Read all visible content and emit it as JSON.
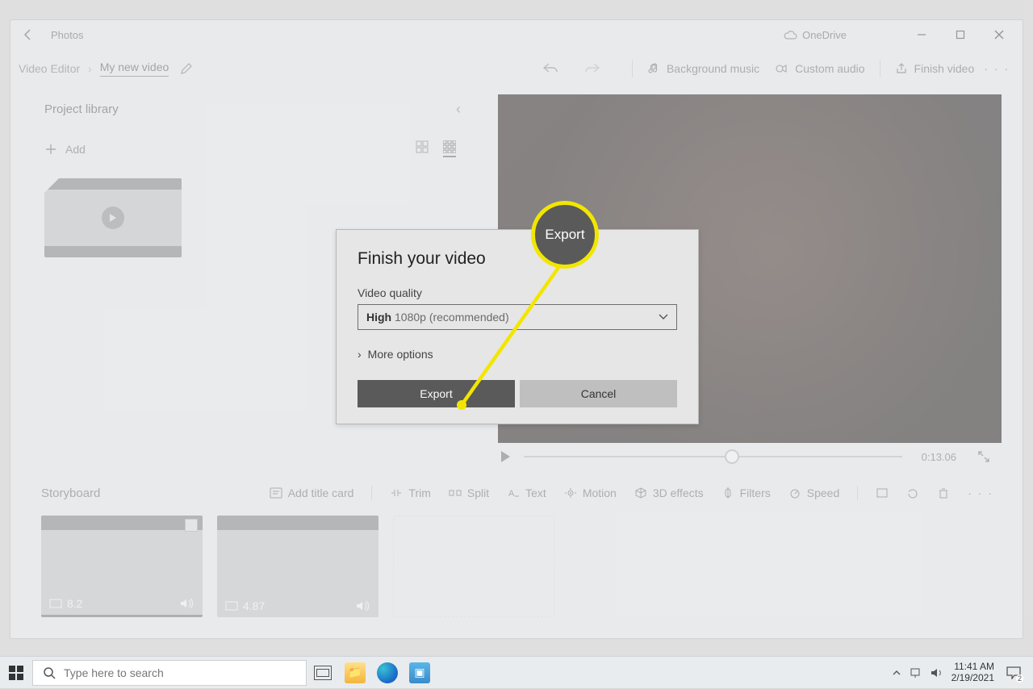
{
  "titlebar": {
    "app_name": "Photos",
    "onedrive_label": "OneDrive"
  },
  "breadcrumb": {
    "root": "Video Editor",
    "current": "My new video"
  },
  "toolbar": {
    "bg_music": "Background music",
    "custom_audio": "Custom audio",
    "finish_video": "Finish video"
  },
  "library": {
    "title": "Project library",
    "add_label": "Add"
  },
  "preview": {
    "time": "0:13.06"
  },
  "storyboard": {
    "title": "Storyboard",
    "add_title_card": "Add title card",
    "trim": "Trim",
    "split": "Split",
    "text": "Text",
    "motion": "Motion",
    "effects3d": "3D effects",
    "filters": "Filters",
    "speed": "Speed",
    "clips": [
      {
        "duration": "8.2"
      },
      {
        "duration": "4.87"
      }
    ]
  },
  "dialog": {
    "title": "Finish your video",
    "quality_label": "Video quality",
    "quality_value_bold": "High",
    "quality_value_rest": "1080p (recommended)",
    "more_options": "More options",
    "export_btn": "Export",
    "cancel_btn": "Cancel"
  },
  "callout": {
    "label": "Export"
  },
  "taskbar": {
    "search_placeholder": "Type here to search",
    "time": "11:41 AM",
    "date": "2/19/2021",
    "notif_count": "2"
  }
}
